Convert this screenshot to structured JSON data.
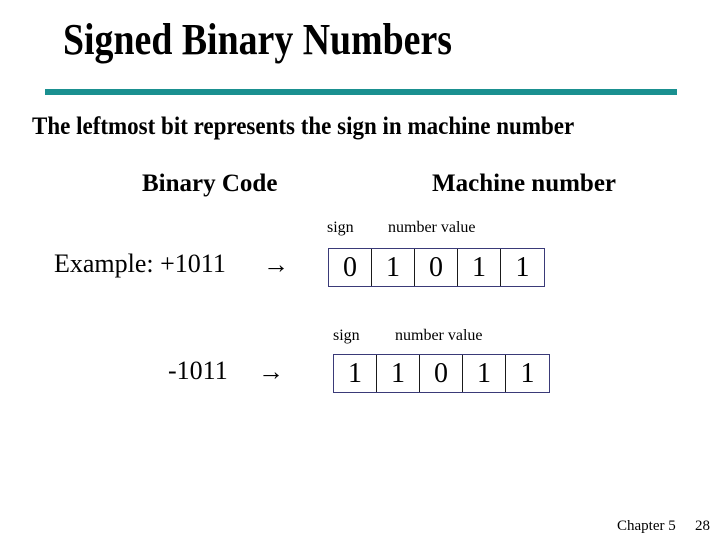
{
  "slide": {
    "title": "Signed Binary Numbers",
    "subtitle": "The leftmost bit represents the sign in machine number",
    "accent_color": "#1a9090"
  },
  "columns": {
    "binary_code": "Binary Code",
    "machine_number": "Machine number"
  },
  "examples": [
    {
      "label": "Example: +1011",
      "arrow": "→",
      "sign_label": "sign",
      "value_label": "number value",
      "bits": [
        "0",
        "1",
        "0",
        "1",
        "1"
      ]
    },
    {
      "label": "-1011",
      "arrow": "→",
      "sign_label": "sign",
      "value_label": "number value",
      "bits": [
        "1",
        "1",
        "0",
        "1",
        "1"
      ]
    }
  ],
  "footer": {
    "chapter": "Chapter 5",
    "page": "28"
  }
}
